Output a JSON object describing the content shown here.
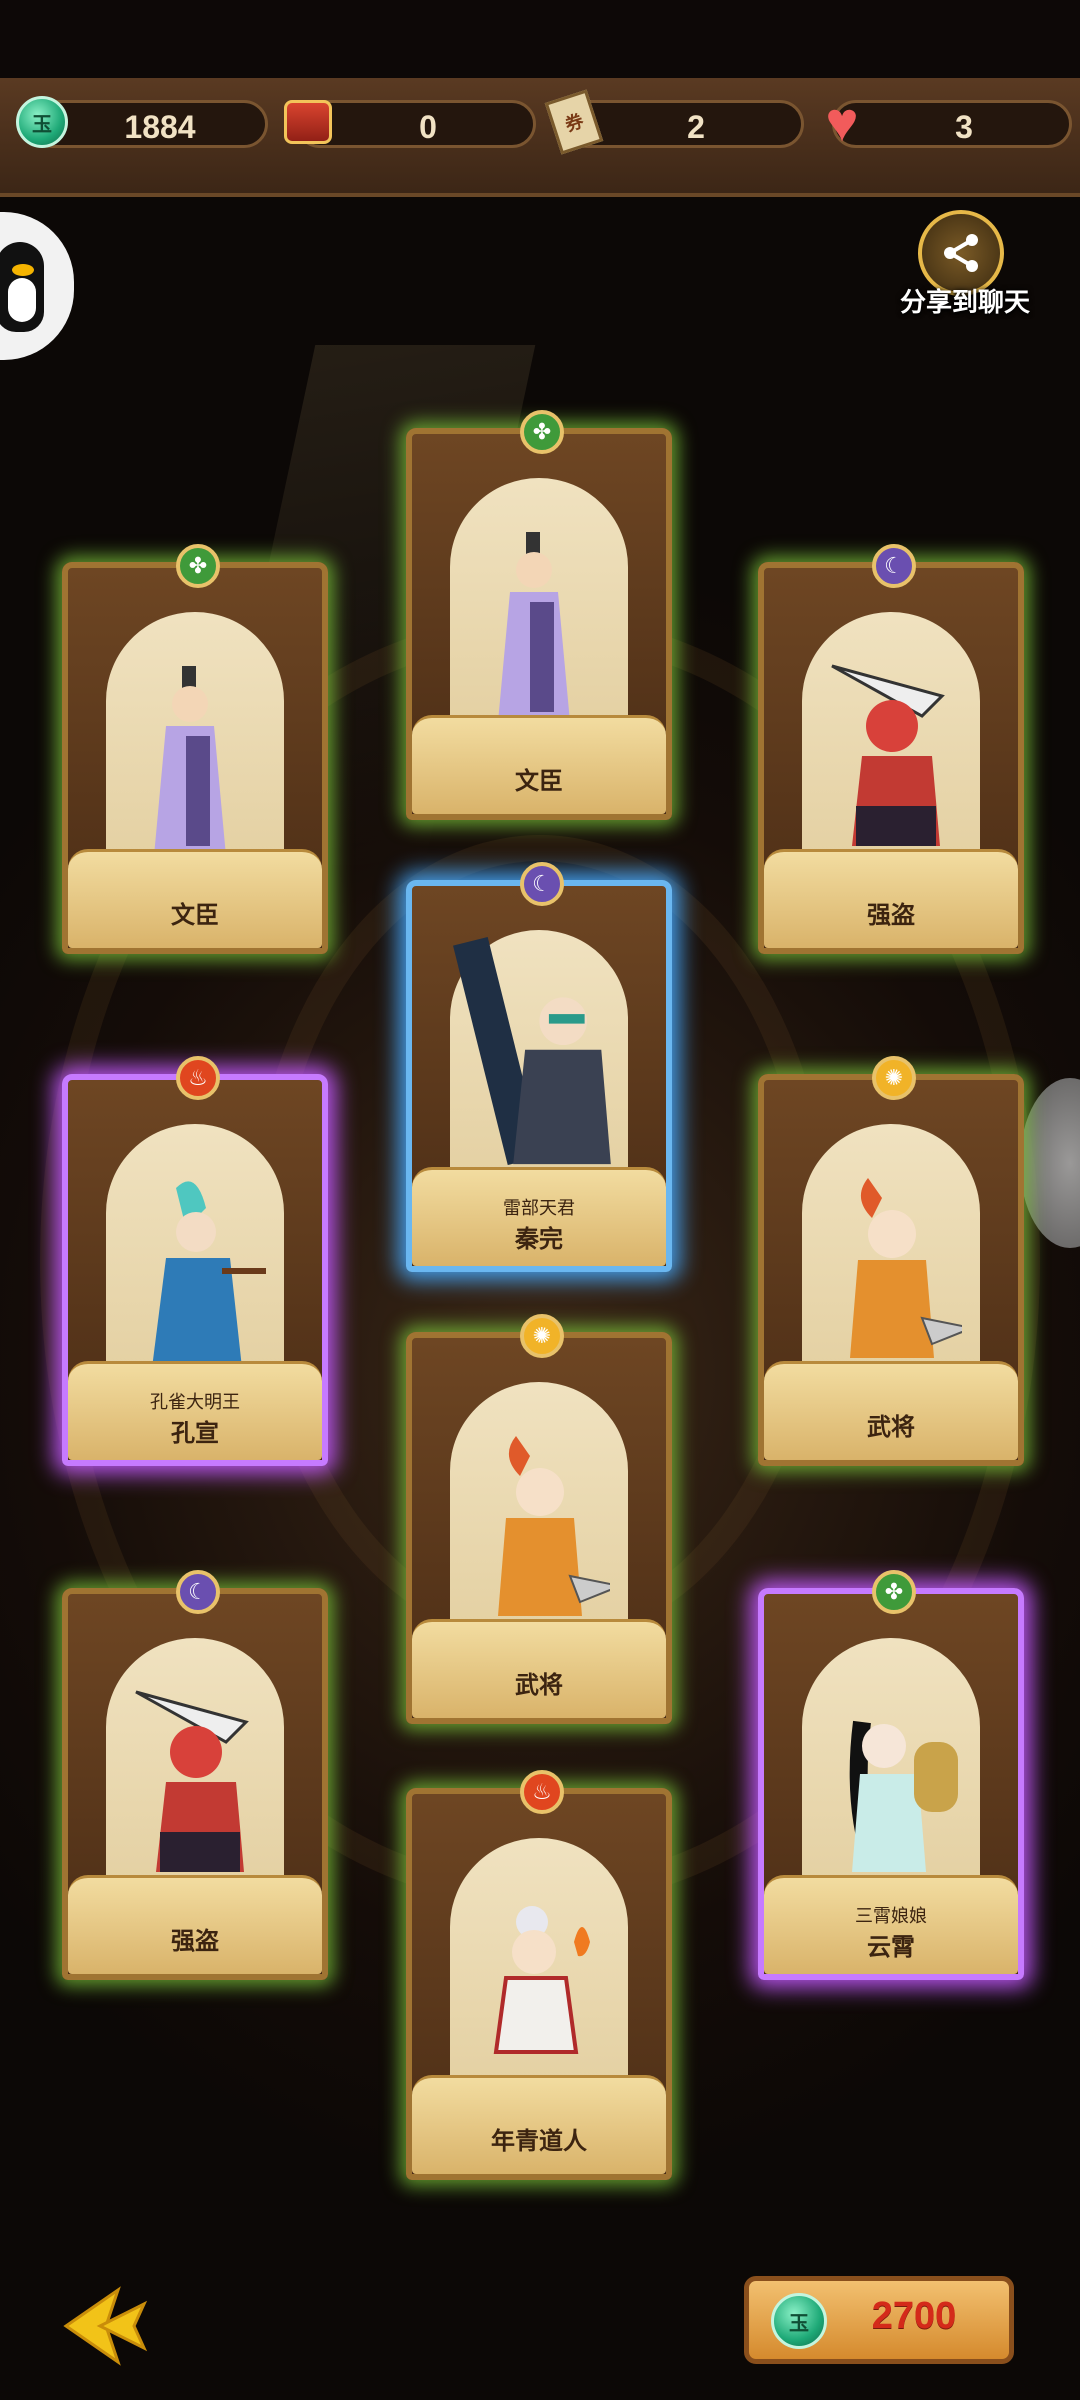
{
  "resources": [
    {
      "icon": "jade-coin-icon",
      "value": "1884"
    },
    {
      "icon": "red-packet-icon",
      "value": "0"
    },
    {
      "icon": "ticket-icon",
      "value": "2",
      "glyph": "券"
    },
    {
      "icon": "heart-icon",
      "value": "3"
    }
  ],
  "jade_glyph": "玉",
  "share_label": "分享到聊天",
  "cards": [
    {
      "id": "wenchen-top",
      "title": "文臣",
      "subtitle": "",
      "emblem": "leaf",
      "glow": "green"
    },
    {
      "id": "wenchen-left",
      "title": "文臣",
      "subtitle": "",
      "emblem": "leaf",
      "glow": "green"
    },
    {
      "id": "qiangdao-right",
      "title": "强盗",
      "subtitle": "",
      "emblem": "moon",
      "glow": "green"
    },
    {
      "id": "qinwan",
      "title": "秦完",
      "subtitle": "雷部天君",
      "emblem": "moon",
      "glow": "blue"
    },
    {
      "id": "kongxuan",
      "title": "孔宣",
      "subtitle": "孔雀大明王",
      "emblem": "fire",
      "glow": "purple"
    },
    {
      "id": "wujiang-right",
      "title": "武将",
      "subtitle": "",
      "emblem": "sun",
      "glow": "green"
    },
    {
      "id": "wujiang-center",
      "title": "武将",
      "subtitle": "",
      "emblem": "sun",
      "glow": "green"
    },
    {
      "id": "qiangdao-left",
      "title": "强盗",
      "subtitle": "",
      "emblem": "moon",
      "glow": "green"
    },
    {
      "id": "yunxiao",
      "title": "云霄",
      "subtitle": "三霄娘娘",
      "emblem": "leaf",
      "glow": "purple"
    },
    {
      "id": "daoren",
      "title": "年青道人",
      "subtitle": "",
      "emblem": "fire",
      "glow": "green"
    }
  ],
  "price": "2700",
  "colors": {
    "accent": "#e6b848",
    "price": "#d42a1a",
    "glow_green": "#7ec83c",
    "glow_blue": "#46aaff",
    "glow_purple": "#c45aff"
  }
}
